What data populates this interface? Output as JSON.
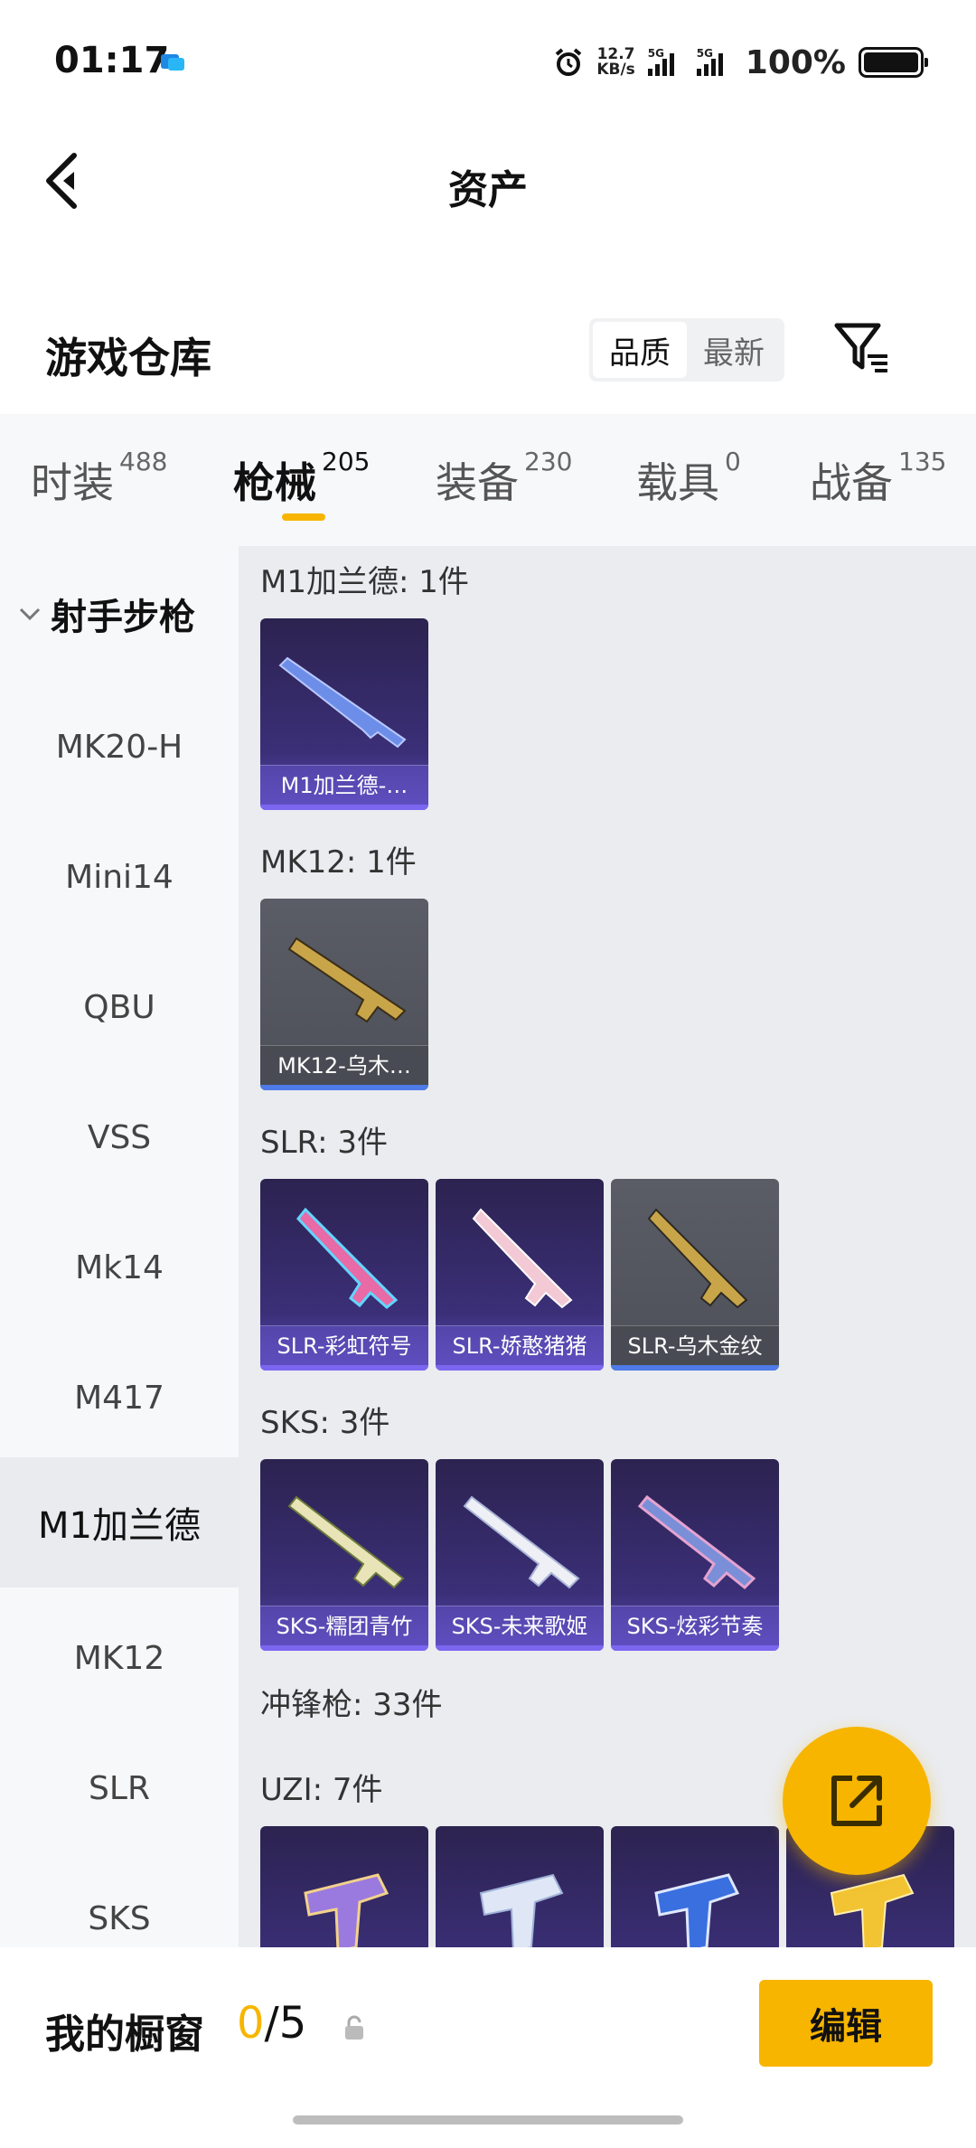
{
  "status_bar": {
    "time": "01:17",
    "net_speed_value": "12.7",
    "net_speed_unit": "KB/s",
    "signal1_label": "5G",
    "signal2_label": "5G",
    "battery_pct": "100%"
  },
  "header": {
    "title": "资产"
  },
  "warehouse": {
    "title": "游戏仓库",
    "sort_options": [
      "品质",
      "最新"
    ],
    "active_sort": "品质"
  },
  "tabs": [
    {
      "label": "时装",
      "count": "488"
    },
    {
      "label": "枪械",
      "count": "205",
      "active": true
    },
    {
      "label": "装备",
      "count": "230"
    },
    {
      "label": "载具",
      "count": "0"
    },
    {
      "label": "战备",
      "count": "135"
    }
  ],
  "sidebar": {
    "group": "射手步枪",
    "items": [
      "MK20-H",
      "Mini14",
      "QBU",
      "VSS",
      "Mk14",
      "M417",
      "M1加兰德",
      "MK12",
      "SLR",
      "SKS"
    ],
    "active": "M1加兰德"
  },
  "content": {
    "sections": [
      {
        "label": "M1加兰德: 1件",
        "items": [
          {
            "name": "M1加兰德-…",
            "rarity": "purple"
          }
        ]
      },
      {
        "label": "MK12: 1件",
        "items": [
          {
            "name": "MK12-乌木…",
            "rarity": "gray"
          }
        ]
      },
      {
        "label": "SLR: 3件",
        "items": [
          {
            "name": "SLR-彩虹符号",
            "rarity": "purple"
          },
          {
            "name": "SLR-娇憨猪猪",
            "rarity": "purple"
          },
          {
            "name": "SLR-乌木金纹",
            "rarity": "gray"
          }
        ]
      },
      {
        "label": "SKS: 3件",
        "items": [
          {
            "name": "SKS-糯团青竹",
            "rarity": "purple"
          },
          {
            "name": "SKS-未来歌姬",
            "rarity": "purple"
          },
          {
            "name": "SKS-炫彩节奏",
            "rarity": "purple"
          }
        ]
      },
      {
        "label": "冲锋枪: 33件",
        "items": []
      },
      {
        "label": "UZI: 7件",
        "items": []
      }
    ]
  },
  "showcase": {
    "label": "我的橱窗",
    "count_current": "0",
    "count_sep_total": "/5",
    "edit_label": "编辑"
  },
  "colors": {
    "accent": "#f7b500",
    "purple_card": "#3b2f78",
    "gray_card": "#55585f"
  }
}
